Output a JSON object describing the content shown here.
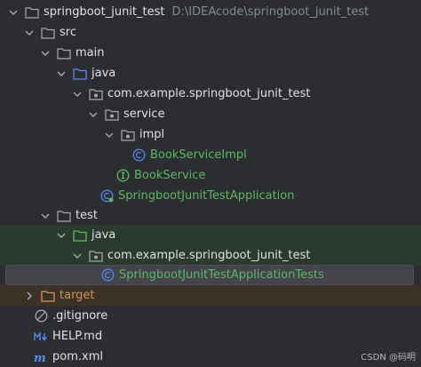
{
  "project": {
    "name": "springboot_junit_test",
    "path": "D:\\IDEAcode\\springboot_junit_test"
  },
  "src": {
    "label": "src"
  },
  "main": {
    "label": "main"
  },
  "main_java": {
    "label": "java"
  },
  "main_package": {
    "label": "com.example.springboot_junit_test"
  },
  "service": {
    "label": "service"
  },
  "impl": {
    "label": "impl"
  },
  "book_service_impl": {
    "label": "BookServiceImpl"
  },
  "book_service": {
    "label": "BookService"
  },
  "app_class": {
    "label": "SpringbootJunitTestApplication"
  },
  "test": {
    "label": "test"
  },
  "test_java": {
    "label": "java"
  },
  "test_package": {
    "label": "com.example.springboot_junit_test"
  },
  "test_class": {
    "label": "SpringbootJunitTestApplicationTests"
  },
  "target": {
    "label": "target"
  },
  "gitignore": {
    "label": ".gitignore"
  },
  "help": {
    "label": "HELP.md"
  },
  "pom": {
    "label": "pom.xml"
  },
  "watermark": "CSDN @码明",
  "colors": {
    "background": "#2b2d30",
    "text": "#dfe1e5",
    "green_text": "#5fb865",
    "orange_text": "#d39558",
    "folder_blue": "#548af7",
    "folder_green": "#5fb865",
    "folder_orange": "#d39558",
    "class_icon": "#548af7",
    "interface_icon": "#5fb865"
  }
}
